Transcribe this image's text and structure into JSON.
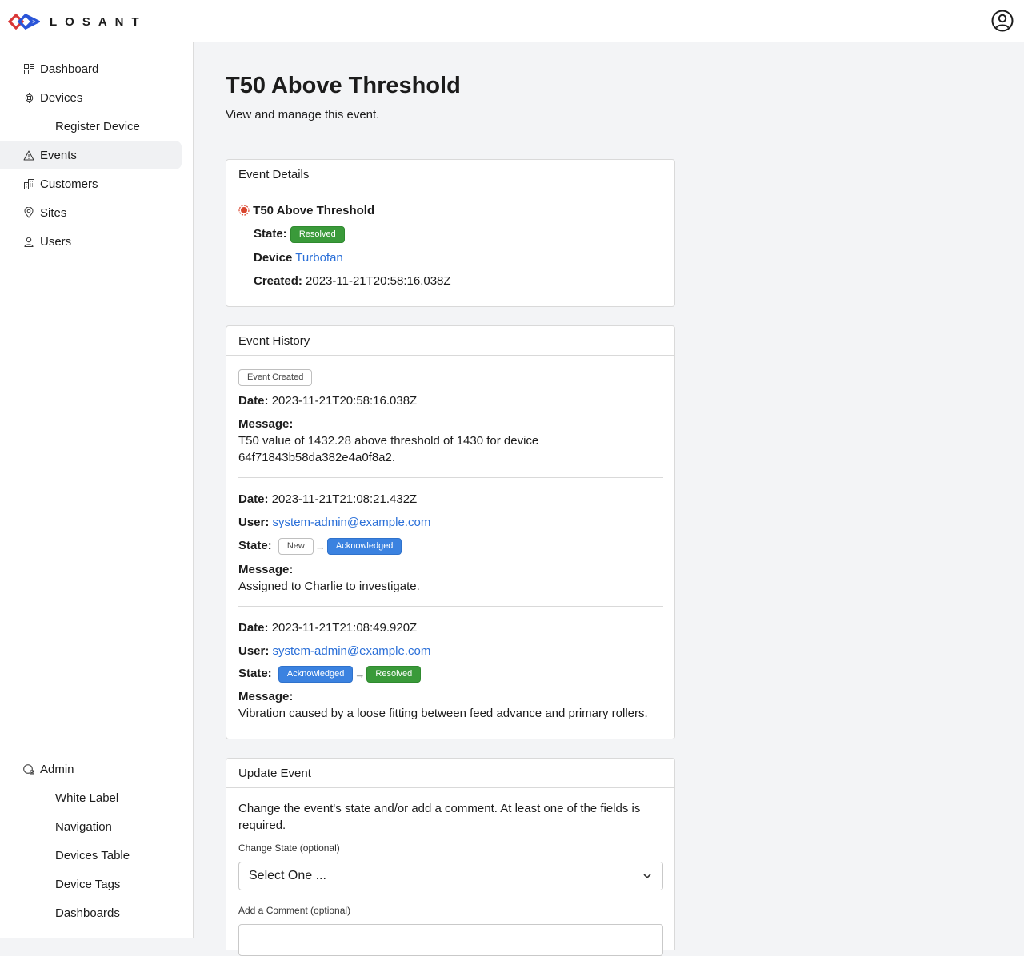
{
  "app": {
    "brand": "LOSANT",
    "accent": "#2a6fd8"
  },
  "sidebar": {
    "items": [
      {
        "label": "Dashboard",
        "icon": "dashboard-grid-icon"
      },
      {
        "label": "Devices",
        "icon": "chip-icon"
      },
      {
        "label": "Register Device",
        "icon": ""
      },
      {
        "label": "Events",
        "icon": "warning-triangle-icon",
        "active": true
      },
      {
        "label": "Customers",
        "icon": "building-icon"
      },
      {
        "label": "Sites",
        "icon": "location-pin-icon"
      },
      {
        "label": "Users",
        "icon": "user-icon"
      }
    ],
    "admin": {
      "label": "Admin",
      "icon": "admin-shield-icon",
      "items": [
        "White Label",
        "Navigation",
        "Devices Table",
        "Device Tags",
        "Dashboards"
      ]
    }
  },
  "page": {
    "title": "T50 Above Threshold",
    "subtitle": "View and manage this event."
  },
  "event_details": {
    "header": "Event Details",
    "name": "T50 Above Threshold",
    "state_label": "State:",
    "state": "Resolved",
    "device_label": "Device",
    "device": "Turbofan",
    "created_label": "Created:",
    "created": "2023-11-21T20:58:16.038Z"
  },
  "event_history": {
    "header": "Event History",
    "labels": {
      "date": "Date:",
      "user": "User:",
      "state": "State:",
      "message": "Message:"
    },
    "entries": [
      {
        "badge": "Event Created",
        "date": "2023-11-21T20:58:16.038Z",
        "message": "T50 value of 1432.28 above threshold of 1430 for device 64f71843b58da382e4a0f8a2."
      },
      {
        "date": "2023-11-21T21:08:21.432Z",
        "user": "system-admin@example.com",
        "from_state": "New",
        "to_state": "Acknowledged",
        "message": "Assigned to Charlie to investigate."
      },
      {
        "date": "2023-11-21T21:08:49.920Z",
        "user": "system-admin@example.com",
        "from_state": "Acknowledged",
        "to_state": "Resolved",
        "message": "Vibration caused by a loose fitting between feed advance and primary rollers."
      }
    ]
  },
  "update_event": {
    "header": "Update Event",
    "description": "Change the event's state and/or add a comment. At least one of the fields is required.",
    "state_label": "Change State (optional)",
    "state_value": "Select One ...",
    "comment_label": "Add a Comment (optional)"
  },
  "colors": {
    "resolved": "#3a9a3a",
    "acknowledged": "#3b82e0"
  }
}
